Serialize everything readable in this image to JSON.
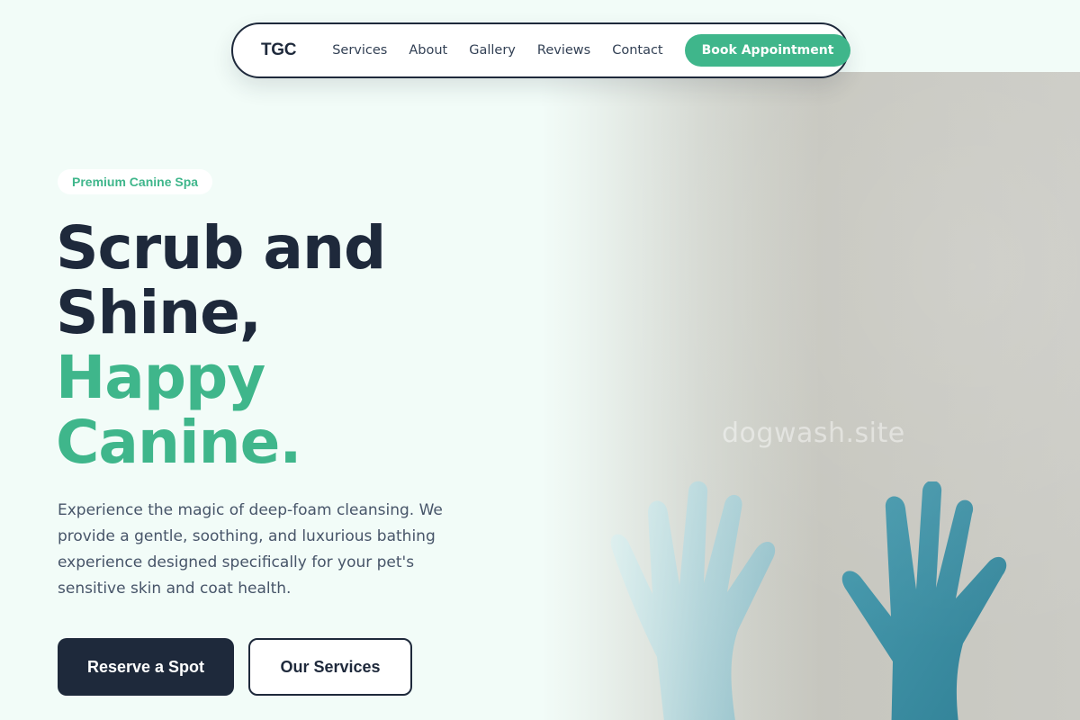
{
  "nav": {
    "logo": "TGC",
    "links": [
      "Services",
      "About",
      "Gallery",
      "Reviews",
      "Contact"
    ],
    "cta": "Book Appointment"
  },
  "hero": {
    "badge": "Premium Canine Spa",
    "headline_lines": [
      "Scrub and",
      "Shine,",
      "Happy",
      "Canine."
    ],
    "description": "Experience the magic of deep-foam cleansing. We provide a gentle, soothing, and luxurious bathing experience designed specifically for your pet's sensitive skin and coat health.",
    "primary_button": "Reserve a Spot",
    "secondary_button": "Our Services",
    "watermark": "dogwash.site",
    "image_subject": "two-gloved-hands-photo"
  },
  "colors": {
    "accent": "#3fb68b",
    "dark": "#1e293b",
    "background": "#f2fcf8",
    "glove_light": "#8ec4d0",
    "glove_dark": "#3c8ea3"
  }
}
